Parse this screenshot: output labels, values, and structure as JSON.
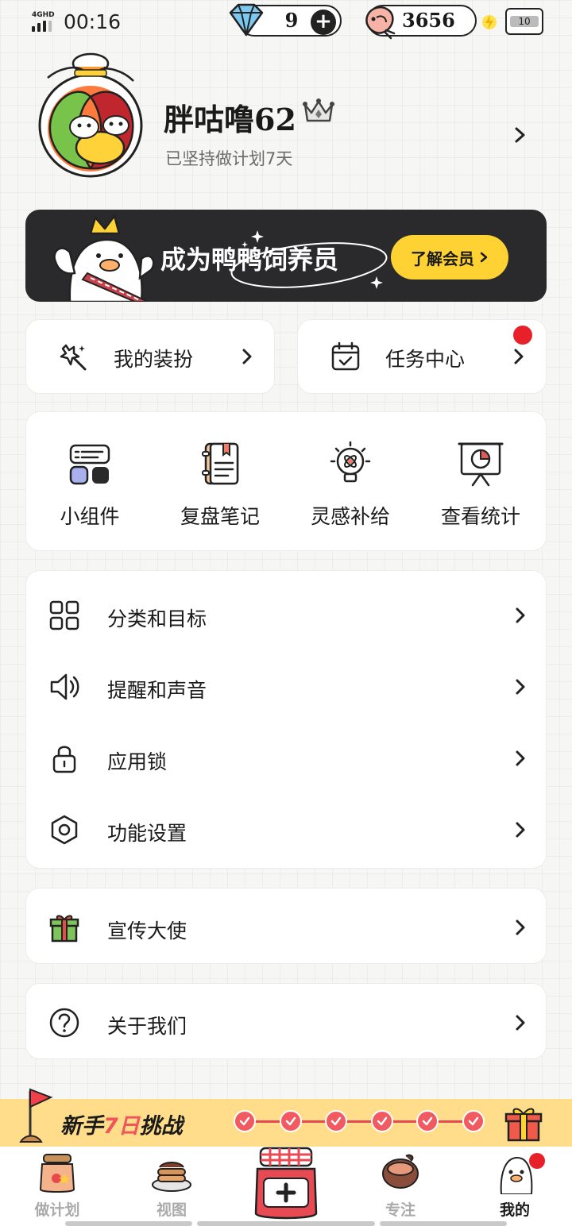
{
  "status_bar": {
    "network": "4GHD",
    "time": "00:16",
    "gems": "9",
    "shrimp": "3656",
    "battery": "10"
  },
  "profile": {
    "username": "胖咕噜62",
    "streak": "已坚持做计划7天"
  },
  "vip_banner": {
    "text": "成为鸭鸭饲养员",
    "button": "了解会员"
  },
  "quick_cards": {
    "dress_up": "我的装扮",
    "task_center": "任务中心"
  },
  "tools": [
    {
      "label": "小组件",
      "icon": "widget-icon"
    },
    {
      "label": "复盘笔记",
      "icon": "notebook-icon"
    },
    {
      "label": "灵感补给",
      "icon": "lightbulb-icon"
    },
    {
      "label": "查看统计",
      "icon": "stats-board-icon"
    }
  ],
  "settings": [
    {
      "label": "分类和目标",
      "icon": "grid-icon"
    },
    {
      "label": "提醒和声音",
      "icon": "speaker-icon"
    },
    {
      "label": "应用锁",
      "icon": "lock-icon"
    },
    {
      "label": "功能设置",
      "icon": "hexagon-settings-icon"
    }
  ],
  "promo": {
    "label": "宣传大使",
    "icon": "gift-box-icon"
  },
  "about": {
    "label": "关于我们",
    "icon": "question-icon"
  },
  "challenge": {
    "title_prefix": "新手",
    "title_seven": "7日",
    "title_suffix": "挑战",
    "days_checked": 6
  },
  "tabs": [
    {
      "label": "做计划",
      "active": false
    },
    {
      "label": "视图",
      "active": false
    },
    {
      "label": "专注",
      "active": false
    },
    {
      "label": "我的",
      "active": true
    }
  ],
  "colors": {
    "accent_yellow": "#ffd233",
    "banner_dark": "#2a2a2c",
    "alert_red": "#e8202a",
    "challenge_bg": "#ffdd8a"
  }
}
